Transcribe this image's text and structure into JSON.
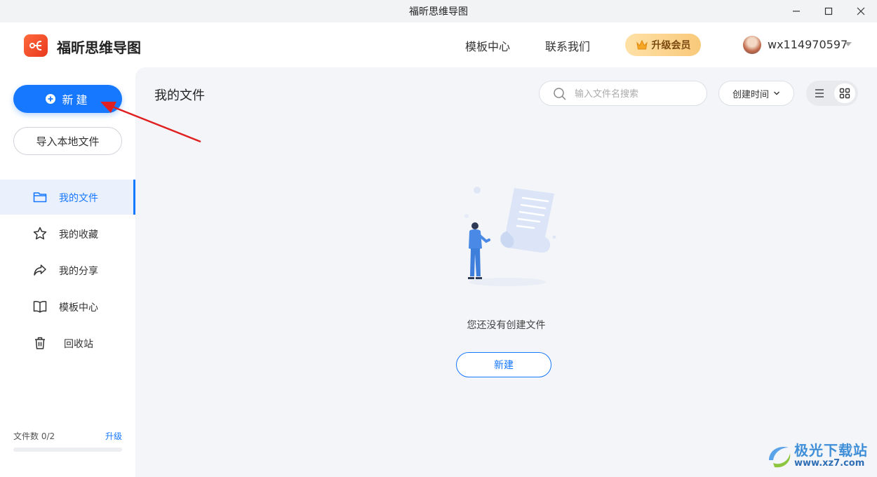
{
  "window": {
    "title": "福昕思维导图"
  },
  "header": {
    "app_name": "福昕思维导图",
    "nav": [
      "模板中心",
      "联系我们"
    ],
    "vip_label": "升级会员",
    "username": "wx114970597"
  },
  "sidebar": {
    "new_label": "新建",
    "import_label": "导入本地文件",
    "items": [
      {
        "label": "我的文件",
        "icon": "folder-icon",
        "active": true
      },
      {
        "label": "我的收藏",
        "icon": "star-icon",
        "active": false
      },
      {
        "label": "我的分享",
        "icon": "share-icon",
        "active": false
      },
      {
        "label": "模板中心",
        "icon": "book-icon",
        "active": false
      },
      {
        "label": "回收站",
        "icon": "trash-icon",
        "active": false
      }
    ],
    "file_count_label": "文件数 0/2",
    "upgrade_label": "升级",
    "storage_used_fraction": 0
  },
  "main": {
    "title": "我的文件",
    "search_placeholder": "输入文件名搜索",
    "sort_label": "创建时间",
    "empty_text": "您还没有创建文件",
    "empty_new_label": "新建"
  },
  "watermark": {
    "title": "极光下载站",
    "url": "www.xz7.com"
  },
  "colors": {
    "accent": "#1677ff",
    "annotation_arrow": "#e02020"
  }
}
